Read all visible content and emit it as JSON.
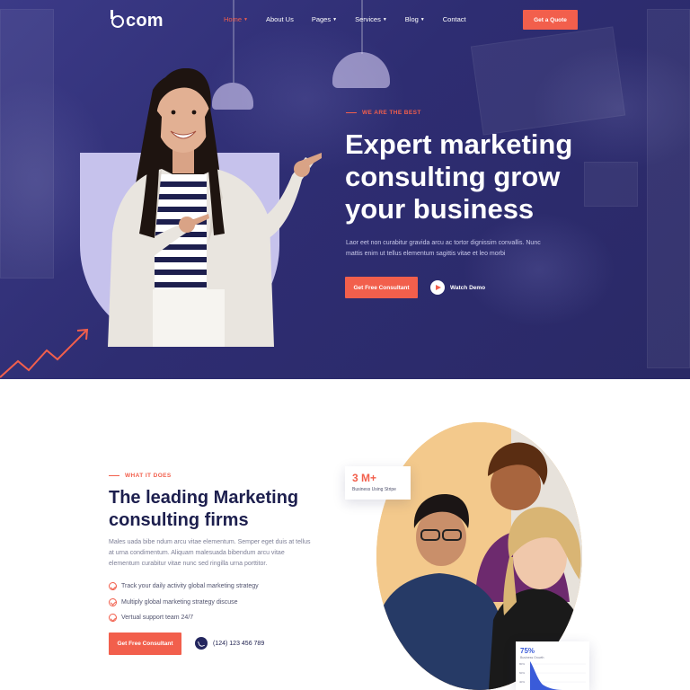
{
  "brand": {
    "logo_text": "com",
    "accent": "#f25f4c",
    "navy": "#2e2d72"
  },
  "nav": {
    "items": [
      {
        "label": "Home",
        "has_caret": true,
        "active": true
      },
      {
        "label": "About Us",
        "has_caret": false,
        "active": false
      },
      {
        "label": "Pages",
        "has_caret": true,
        "active": false
      },
      {
        "label": "Services",
        "has_caret": true,
        "active": false
      },
      {
        "label": "Blog",
        "has_caret": true,
        "active": false
      },
      {
        "label": "Contact",
        "has_caret": false,
        "active": false
      }
    ],
    "quote_button": "Get a Quote"
  },
  "hero": {
    "eyebrow": "WE ARE THE BEST",
    "title_line1": "Expert marketing",
    "title_line2": "consulting grow",
    "title_line3": "your business",
    "desc_line1": "Laor eet non curabitur gravida arcu ac tortor dignissim convallis. Nunc",
    "desc_line2": "mattis enim ut tellus elementum sagittis vitae et leo morbi",
    "cta": "Get Free Consultant",
    "watch_demo": "Watch Demo"
  },
  "about": {
    "eyebrow": "WHAT IT DOES",
    "title_line1": "The leading Marketing",
    "title_line2": "consulting firms",
    "desc_line1": "Males uada bibe ndum arcu vitae elementum. Semper eget duis at tellus",
    "desc_line2": "at urna condimentum. Aliquam malesuada bibendum arcu vitae",
    "desc_line3": "elementum curabitur vitae nunc sed ringilla urna porttitor.",
    "checklist": [
      "Track your daily activity global marketing strategy",
      "Multiply global marketing strategy discuse",
      "Vertual support team 24/7"
    ],
    "cta": "Get Free Consultant",
    "phone": "(124) 123 456 789",
    "stat": {
      "value": "3 M+",
      "label": "Business Using Stripe"
    },
    "growth": {
      "value": "75%",
      "label": "Business Growth",
      "ticks": [
        "80%",
        "60%",
        "40%"
      ]
    }
  }
}
